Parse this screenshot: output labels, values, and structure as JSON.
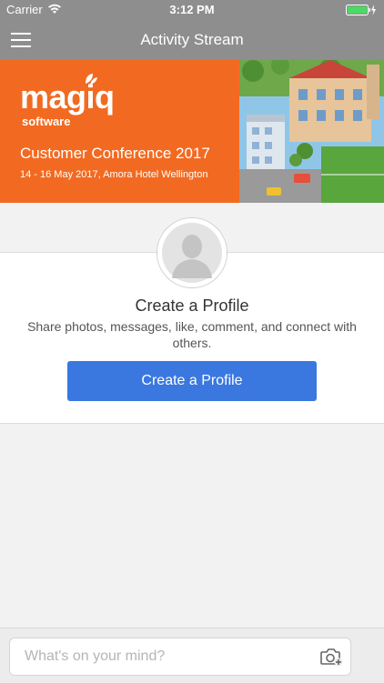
{
  "status_bar": {
    "carrier": "Carrier",
    "time": "3:12 PM",
    "battery_color": "#4cd964"
  },
  "nav": {
    "title": "Activity Stream",
    "menu_icon": "hamburger-menu-icon"
  },
  "banner": {
    "brand": "magiq",
    "brand_sub": "software",
    "headline": "Customer Conference 2017",
    "subline": "14 - 16 May 2017, Amora Hotel Wellington",
    "bg_color": "#f26a21"
  },
  "profile": {
    "avatar_icon": "default-avatar-icon",
    "heading": "Create a Profile",
    "description": "Share photos, messages, like, comment, and connect with others.",
    "button_label": "Create a Profile",
    "button_color": "#3a78e0"
  },
  "composer": {
    "placeholder": "What's on your mind?",
    "camera_icon": "add-photo-icon"
  }
}
